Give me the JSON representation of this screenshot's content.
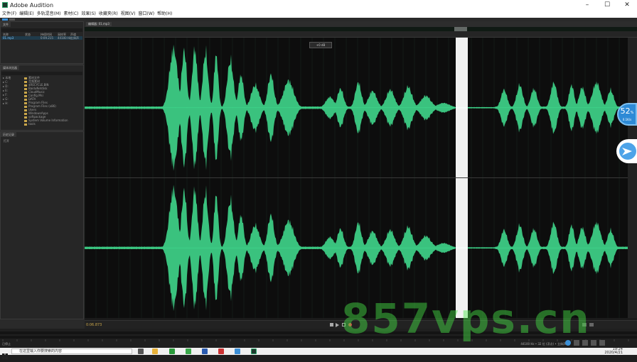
{
  "window": {
    "title": "Adobe Audition",
    "app_icon": "audition-icon"
  },
  "menu": [
    "文件(F)",
    "编辑(E)",
    "多轨混音(M)",
    "素材(C)",
    "效果(S)",
    "收藏夹(R)",
    "视图(V)",
    "窗口(W)",
    "帮助(H)"
  ],
  "files_panel": {
    "tab": "文件",
    "columns": [
      "名称",
      "状态",
      "持续时间",
      "采样率",
      "声道"
    ],
    "row": {
      "name": "01.mp3",
      "duration": "0:09.215",
      "rate": "44100 Hz",
      "channels": "立体声"
    }
  },
  "media_panel": {
    "tab": "媒体浏览器",
    "items": [
      "本地",
      "C:",
      "D:",
      "E:",
      "F:",
      "G:",
      "H:"
    ],
    "folders": [
      "素材文件",
      "音频素材",
      "$RECYCLE.BIN",
      "BaiduNetdisk",
      "CloudMusic",
      "Config.Msi",
      "DATA",
      "Program Files",
      "Program Files (x86)",
      "Users",
      "WindowsApps",
      "softpackage",
      "System Volume Information",
      "tools"
    ]
  },
  "history_panel": {
    "tab": "历史记录",
    "item": "打开"
  },
  "editor": {
    "tab": "编辑器: 01.mp3",
    "clip_label": "+0 dB"
  },
  "transport": {
    "time": "0:06.873"
  },
  "status": {
    "left": "已停止",
    "right": "44100 Hz • 32 位 (浮点) • 立体声"
  },
  "taskbar": {
    "search_placeholder": "在这里输入你要搜索的内容",
    "clock_time": "19:24",
    "clock_date": "2020/4/21"
  },
  "speed_widget": {
    "percent": "52",
    "unit": "%",
    "rate": "0.1K/s"
  },
  "watermark": "857vps.cn",
  "colors": {
    "wave": "#3fd68b",
    "accent": "#c9a64a",
    "background": "#0d0d0d"
  }
}
